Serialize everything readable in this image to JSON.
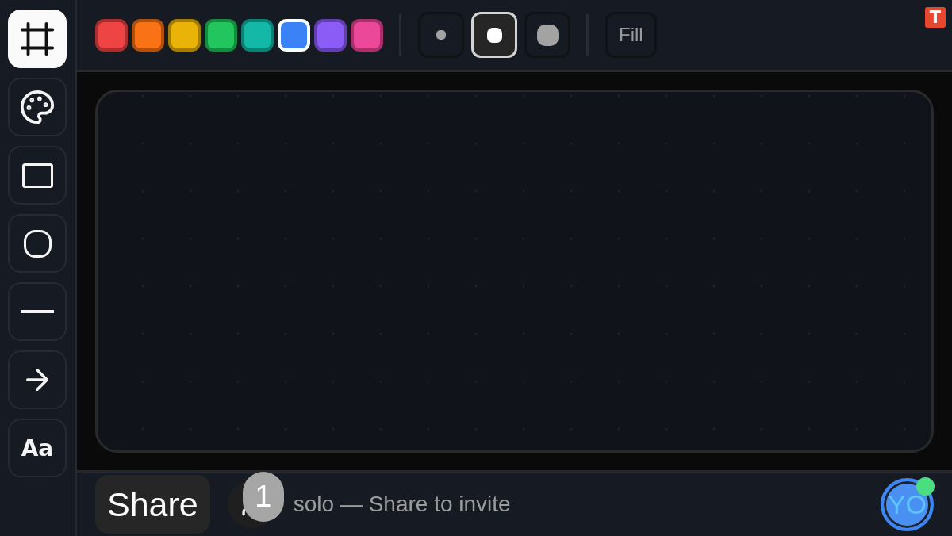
{
  "tools": [
    {
      "kind": "frame",
      "selected": true
    },
    {
      "kind": "palette",
      "selected": false
    },
    {
      "kind": "rectangle",
      "selected": false
    },
    {
      "kind": "ellipse",
      "selected": false
    },
    {
      "kind": "line",
      "selected": false
    },
    {
      "kind": "arrow",
      "selected": false
    },
    {
      "kind": "text",
      "label": "Aa",
      "selected": false
    }
  ],
  "colors": [
    {
      "color": "#ef4444",
      "selected": false
    },
    {
      "color": "#f97316",
      "selected": false
    },
    {
      "color": "#eab308",
      "selected": false
    },
    {
      "color": "#22c55e",
      "selected": false
    },
    {
      "color": "#14b8a6",
      "selected": false
    },
    {
      "color": "#3b82f6",
      "selected": true
    },
    {
      "color": "#8b5cf6",
      "selected": false
    },
    {
      "color": "#ec4899",
      "selected": false
    }
  ],
  "stroke_sizes": [
    {
      "kind": "small",
      "selected": false
    },
    {
      "kind": "medium",
      "selected": true
    },
    {
      "kind": "large",
      "selected": false
    }
  ],
  "fill": {
    "label": "Fill",
    "on": false
  },
  "logo": {
    "text": "T"
  },
  "share_button": {
    "label": "Share"
  },
  "participants": {
    "count": "1",
    "status": "solo — Share to invite"
  },
  "user_avatar": {
    "initials": "YO",
    "online": true
  }
}
